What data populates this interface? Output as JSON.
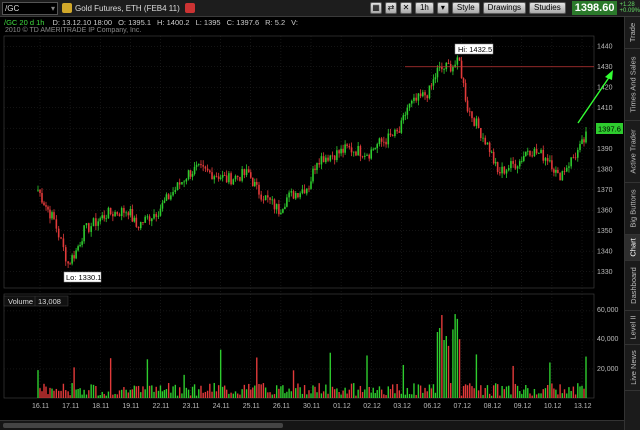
{
  "toolbar": {
    "symbol": "/GC",
    "instrument_label": "Gold Futures, ETH (FEB4 11)",
    "timeframe": "1h",
    "style_label": "Style",
    "drawings_label": "Drawings",
    "studies_label": "Studies",
    "last_price": "1398.60",
    "change_top": "+1.28",
    "change_bottom": "+0.09%",
    "icons": [
      "chart-settings-icon",
      "link-icon",
      "gear-icon",
      "close-icon",
      "crosshair-icon",
      "zoom-icon"
    ]
  },
  "infobar": {
    "symbol": "/GC 20 d 1h",
    "date": "D: 13.12.10 18:00",
    "open": "O: 1395.1",
    "high": "H: 1400.2",
    "low": "L: 1395",
    "close": "C: 1397.6",
    "range": "R: 5.2",
    "volume_flag": "V:"
  },
  "copyright": "2010 © TD AMERITRADE IP Company, Inc.",
  "annotations": {
    "high_label": "Hi: 1432.5",
    "low_label": "Lo: 1330.1",
    "current_price_tag": "1397.6"
  },
  "volume_panel": {
    "label": "Volume",
    "value": "13,008",
    "axis_ticks": [
      "60,000",
      "40,000",
      "20,000"
    ]
  },
  "side_tabs": [
    "Trade",
    "Times And Sales",
    "Active Trader",
    "Big Buttons",
    "Chart",
    "Dashboard",
    "Level II",
    "Live News"
  ],
  "colors": {
    "up": "#2ecc2e",
    "down": "#e23a3a",
    "price_line": "#c23636",
    "arrow": "#33ff33",
    "grid": "#333333"
  },
  "chart_data": {
    "type": "candlestick",
    "price_axis": {
      "ticks": [
        1330,
        1340,
        1350,
        1360,
        1370,
        1380,
        1390,
        1400,
        1410,
        1420,
        1430,
        1440
      ],
      "range": [
        1322,
        1445
      ]
    },
    "x_ticks": [
      "16.11",
      "17.11",
      "18.11",
      "19.11",
      "22.11",
      "23.11",
      "24.11",
      "25.11",
      "26.11",
      "30.11",
      "01.12",
      "02.12",
      "03.12",
      "06.12",
      "07.12",
      "08.12",
      "09.12",
      "10.12",
      "13.12"
    ],
    "high": 1432.5,
    "low": 1330.1,
    "current": 1397.6,
    "horizontal_line": 1430,
    "close_path": [
      {
        "x": "16.11",
        "close": 1370
      },
      {
        "x": "16.11",
        "close": 1362
      },
      {
        "x": "16.11",
        "close": 1355
      },
      {
        "x": "17.11",
        "close": 1334
      },
      {
        "x": "17.11",
        "close": 1340
      },
      {
        "x": "17.11",
        "close": 1350
      },
      {
        "x": "18.11",
        "close": 1355
      },
      {
        "x": "18.11",
        "close": 1358
      },
      {
        "x": "19.11",
        "close": 1360
      },
      {
        "x": "19.11",
        "close": 1352
      },
      {
        "x": "22.11",
        "close": 1360
      },
      {
        "x": "22.11",
        "close": 1365
      },
      {
        "x": "23.11",
        "close": 1378
      },
      {
        "x": "23.11",
        "close": 1380
      },
      {
        "x": "24.11",
        "close": 1377
      },
      {
        "x": "24.11",
        "close": 1375
      },
      {
        "x": "25.11",
        "close": 1378
      },
      {
        "x": "25.11",
        "close": 1370
      },
      {
        "x": "26.11",
        "close": 1360
      },
      {
        "x": "26.11",
        "close": 1366
      },
      {
        "x": "30.11",
        "close": 1372
      },
      {
        "x": "30.11",
        "close": 1385
      },
      {
        "x": "01.12",
        "close": 1388
      },
      {
        "x": "01.12",
        "close": 1390
      },
      {
        "x": "02.12",
        "close": 1388
      },
      {
        "x": "02.12",
        "close": 1392
      },
      {
        "x": "03.12",
        "close": 1398
      },
      {
        "x": "03.12",
        "close": 1410
      },
      {
        "x": "06.12",
        "close": 1418
      },
      {
        "x": "06.12",
        "close": 1428
      },
      {
        "x": "07.12",
        "close": 1432
      },
      {
        "x": "07.12",
        "close": 1410
      },
      {
        "x": "08.12",
        "close": 1390
      },
      {
        "x": "08.12",
        "close": 1378
      },
      {
        "x": "09.12",
        "close": 1384
      },
      {
        "x": "09.12",
        "close": 1390
      },
      {
        "x": "10.12",
        "close": 1385
      },
      {
        "x": "10.12",
        "close": 1376
      },
      {
        "x": "13.12",
        "close": 1390
      },
      {
        "x": "13.12",
        "close": 1397.6
      }
    ],
    "volume_axis": {
      "range": [
        0,
        62000
      ]
    },
    "volume_peak": 58000
  }
}
